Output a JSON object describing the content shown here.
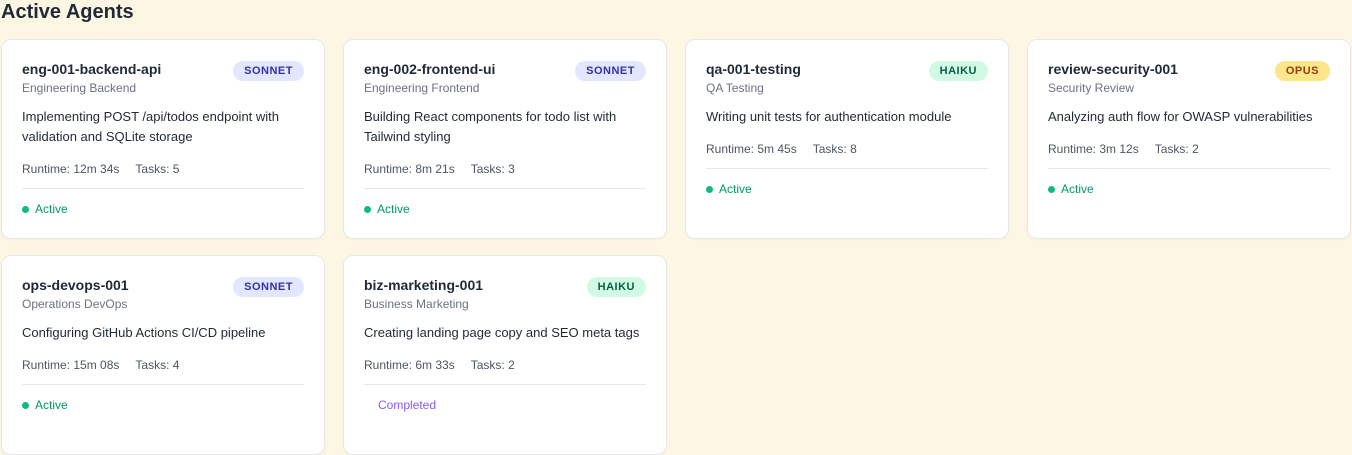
{
  "page": {
    "title": "Active Agents"
  },
  "labels": {
    "runtime": "Runtime:",
    "tasks": "Tasks:"
  },
  "colors": {
    "background": "#fdf6e3",
    "active": "#10b981",
    "completed": "#8b5cf6",
    "sonnet_badge": "#e0e7ff",
    "haiku_badge": "#d1fae5",
    "opus_badge": "#fde68a"
  },
  "agents": [
    {
      "id": "eng-001-backend-api",
      "department": "Engineering Backend",
      "model": "SONNET",
      "model_class": "sonnet",
      "description": "Implementing POST /api/todos endpoint with validation and SQLite storage",
      "runtime": "12m 34s",
      "tasks": "5",
      "status": "Active",
      "status_class": "active"
    },
    {
      "id": "eng-002-frontend-ui",
      "department": "Engineering Frontend",
      "model": "SONNET",
      "model_class": "sonnet",
      "description": "Building React components for todo list with Tailwind styling",
      "runtime": "8m 21s",
      "tasks": "3",
      "status": "Active",
      "status_class": "active"
    },
    {
      "id": "qa-001-testing",
      "department": "QA Testing",
      "model": "HAIKU",
      "model_class": "haiku",
      "description": "Writing unit tests for authentication module",
      "runtime": "5m 45s",
      "tasks": "8",
      "status": "Active",
      "status_class": "active"
    },
    {
      "id": "review-security-001",
      "department": "Security Review",
      "model": "OPUS",
      "model_class": "opus",
      "description": "Analyzing auth flow for OWASP vulnerabilities",
      "runtime": "3m 12s",
      "tasks": "2",
      "status": "Active",
      "status_class": "active"
    },
    {
      "id": "ops-devops-001",
      "department": "Operations DevOps",
      "model": "SONNET",
      "model_class": "sonnet",
      "description": "Configuring GitHub Actions CI/CD pipeline",
      "runtime": "15m 08s",
      "tasks": "4",
      "status": "Active",
      "status_class": "active"
    },
    {
      "id": "biz-marketing-001",
      "department": "Business Marketing",
      "model": "HAIKU",
      "model_class": "haiku",
      "description": "Creating landing page copy and SEO meta tags",
      "runtime": "6m 33s",
      "tasks": "2",
      "status": "Completed",
      "status_class": "completed"
    }
  ]
}
